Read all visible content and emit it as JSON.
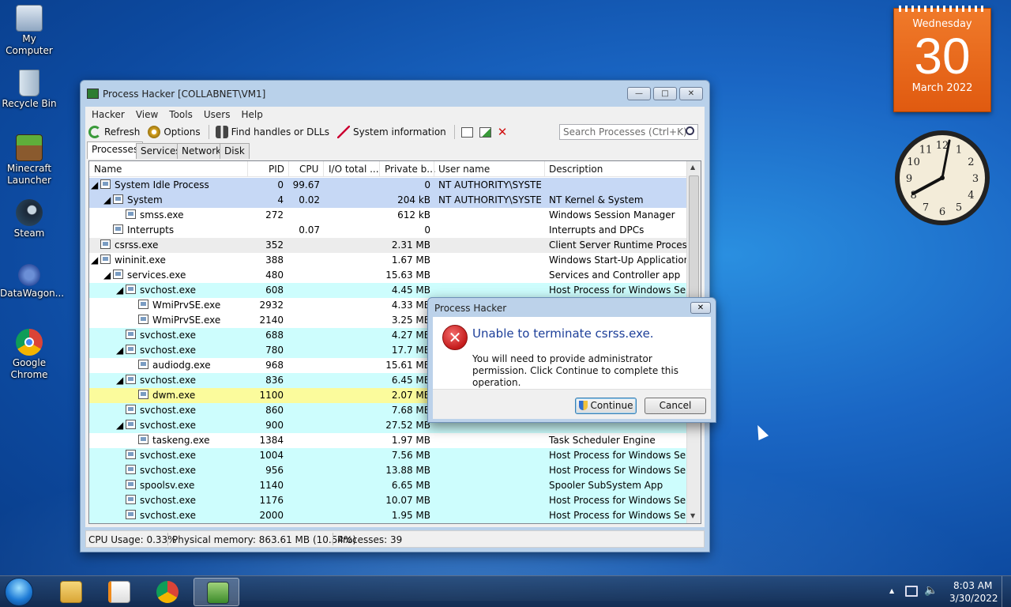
{
  "desktop": {
    "icons": [
      {
        "label": "My Computer"
      },
      {
        "label": "Recycle Bin"
      },
      {
        "label": "Minecraft Launcher"
      },
      {
        "label": "Steam"
      },
      {
        "label": "DataWagon..."
      },
      {
        "label": "Google Chrome"
      }
    ]
  },
  "calendar": {
    "weekday": "Wednesday",
    "day": "30",
    "month_year": "March 2022"
  },
  "clock": {
    "numerals": [
      "12",
      "1",
      "2",
      "3",
      "4",
      "5",
      "6",
      "7",
      "8",
      "9",
      "10",
      "11"
    ]
  },
  "window": {
    "title": "Process Hacker [COLLABNET\\VM1]",
    "minimize": "—",
    "maximize": "□",
    "close": "✕",
    "menu": [
      "Hacker",
      "View",
      "Tools",
      "Users",
      "Help"
    ],
    "toolbar": {
      "refresh": "Refresh",
      "options": "Options",
      "find_handles": "Find handles or DLLs",
      "system_info": "System information",
      "search_placeholder": "Search Processes (Ctrl+K)"
    },
    "tabs": [
      "Processes",
      "Services",
      "Network",
      "Disk"
    ],
    "columns": [
      "Name",
      "PID",
      "CPU",
      "I/O total ...",
      "Private b...",
      "User name",
      "Description"
    ],
    "rows": [
      {
        "name": "System Idle Process",
        "pid": "0",
        "cpu": "99.67",
        "io": "",
        "priv": "0",
        "user": "NT AUTHORITY\\SYSTEM",
        "desc": "",
        "level": 0,
        "expander": "◢",
        "bg": "#c6d8f5"
      },
      {
        "name": "System",
        "pid": "4",
        "cpu": "0.02",
        "io": "",
        "priv": "204 kB",
        "user": "NT AUTHORITY\\SYSTEM",
        "desc": "NT Kernel & System",
        "level": 1,
        "expander": "◢",
        "bg": "#c6d8f5"
      },
      {
        "name": "smss.exe",
        "pid": "272",
        "cpu": "",
        "io": "",
        "priv": "612 kB",
        "user": "",
        "desc": "Windows Session Manager",
        "level": 2,
        "expander": "",
        "bg": "#ffffff"
      },
      {
        "name": "Interrupts",
        "pid": "",
        "cpu": "0.07",
        "io": "",
        "priv": "0",
        "user": "",
        "desc": "Interrupts and DPCs",
        "level": 1,
        "expander": "",
        "bg": "#ffffff"
      },
      {
        "name": "csrss.exe",
        "pid": "352",
        "cpu": "",
        "io": "",
        "priv": "2.31 MB",
        "user": "",
        "desc": "Client Server Runtime Process",
        "level": 0,
        "expander": "",
        "bg": "#ececec"
      },
      {
        "name": "wininit.exe",
        "pid": "388",
        "cpu": "",
        "io": "",
        "priv": "1.67 MB",
        "user": "",
        "desc": "Windows Start-Up Application",
        "level": 0,
        "expander": "◢",
        "bg": "#ffffff"
      },
      {
        "name": "services.exe",
        "pid": "480",
        "cpu": "",
        "io": "",
        "priv": "15.63 MB",
        "user": "",
        "desc": "Services and Controller app",
        "level": 1,
        "expander": "◢",
        "bg": "#ffffff"
      },
      {
        "name": "svchost.exe",
        "pid": "608",
        "cpu": "",
        "io": "",
        "priv": "4.45 MB",
        "user": "",
        "desc": "Host Process for Windows Ser...",
        "level": 2,
        "expander": "◢",
        "bg": "#cdfdfd"
      },
      {
        "name": "WmiPrvSE.exe",
        "pid": "2932",
        "cpu": "",
        "io": "",
        "priv": "4.33 MB",
        "user": "",
        "desc": "",
        "level": 3,
        "expander": "",
        "bg": "#ffffff"
      },
      {
        "name": "WmiPrvSE.exe",
        "pid": "2140",
        "cpu": "",
        "io": "",
        "priv": "3.25 MB",
        "user": "",
        "desc": "",
        "level": 3,
        "expander": "",
        "bg": "#ffffff"
      },
      {
        "name": "svchost.exe",
        "pid": "688",
        "cpu": "",
        "io": "",
        "priv": "4.27 MB",
        "user": "",
        "desc": "",
        "level": 2,
        "expander": "",
        "bg": "#cdfdfd"
      },
      {
        "name": "svchost.exe",
        "pid": "780",
        "cpu": "",
        "io": "",
        "priv": "17.7 MB",
        "user": "",
        "desc": "",
        "level": 2,
        "expander": "◢",
        "bg": "#cdfdfd"
      },
      {
        "name": "audiodg.exe",
        "pid": "968",
        "cpu": "",
        "io": "",
        "priv": "15.61 MB",
        "user": "",
        "desc": "",
        "level": 3,
        "expander": "",
        "bg": "#ffffff"
      },
      {
        "name": "svchost.exe",
        "pid": "836",
        "cpu": "",
        "io": "",
        "priv": "6.45 MB",
        "user": "",
        "desc": "",
        "level": 2,
        "expander": "◢",
        "bg": "#cdfdfd"
      },
      {
        "name": "dwm.exe",
        "pid": "1100",
        "cpu": "",
        "io": "",
        "priv": "2.07 MB",
        "user": "",
        "desc": "",
        "level": 3,
        "expander": "",
        "bg": "#fbfb9c"
      },
      {
        "name": "svchost.exe",
        "pid": "860",
        "cpu": "",
        "io": "",
        "priv": "7.68 MB",
        "user": "",
        "desc": "",
        "level": 2,
        "expander": "",
        "bg": "#cdfdfd"
      },
      {
        "name": "svchost.exe",
        "pid": "900",
        "cpu": "",
        "io": "",
        "priv": "27.52 MB",
        "user": "",
        "desc": "",
        "level": 2,
        "expander": "◢",
        "bg": "#cdfdfd"
      },
      {
        "name": "taskeng.exe",
        "pid": "1384",
        "cpu": "",
        "io": "",
        "priv": "1.97 MB",
        "user": "",
        "desc": "Task Scheduler Engine",
        "level": 3,
        "expander": "",
        "bg": "#ffffff"
      },
      {
        "name": "svchost.exe",
        "pid": "1004",
        "cpu": "",
        "io": "",
        "priv": "7.56 MB",
        "user": "",
        "desc": "Host Process for Windows Ser...",
        "level": 2,
        "expander": "",
        "bg": "#cdfdfd"
      },
      {
        "name": "svchost.exe",
        "pid": "956",
        "cpu": "",
        "io": "",
        "priv": "13.88 MB",
        "user": "",
        "desc": "Host Process for Windows Ser...",
        "level": 2,
        "expander": "",
        "bg": "#cdfdfd"
      },
      {
        "name": "spoolsv.exe",
        "pid": "1140",
        "cpu": "",
        "io": "",
        "priv": "6.65 MB",
        "user": "",
        "desc": "Spooler SubSystem App",
        "level": 2,
        "expander": "",
        "bg": "#cdfdfd"
      },
      {
        "name": "svchost.exe",
        "pid": "1176",
        "cpu": "",
        "io": "",
        "priv": "10.07 MB",
        "user": "",
        "desc": "Host Process for Windows Ser...",
        "level": 2,
        "expander": "",
        "bg": "#cdfdfd"
      },
      {
        "name": "svchost.exe",
        "pid": "2000",
        "cpu": "",
        "io": "",
        "priv": "1.95 MB",
        "user": "",
        "desc": "Host Process for Windows Ser...",
        "level": 2,
        "expander": "",
        "bg": "#cdfdfd"
      }
    ],
    "status": {
      "cpu": "CPU Usage: 0.33%",
      "memory": "Physical memory: 863.61 MB (10.54%)",
      "processes": "Processes: 39"
    }
  },
  "dialog": {
    "title": "Process Hacker",
    "close": "✕",
    "icon": "✕",
    "main": "Unable to terminate csrss.exe.",
    "sub": "You will need to provide administrator permission. Click Continue to complete this operation.",
    "continue": "Continue",
    "cancel": "Cancel"
  },
  "taskbar": {
    "time": "8:03 AM",
    "date": "3/30/2022",
    "tray_arrow": "▲",
    "volume_icon": "🔈"
  }
}
